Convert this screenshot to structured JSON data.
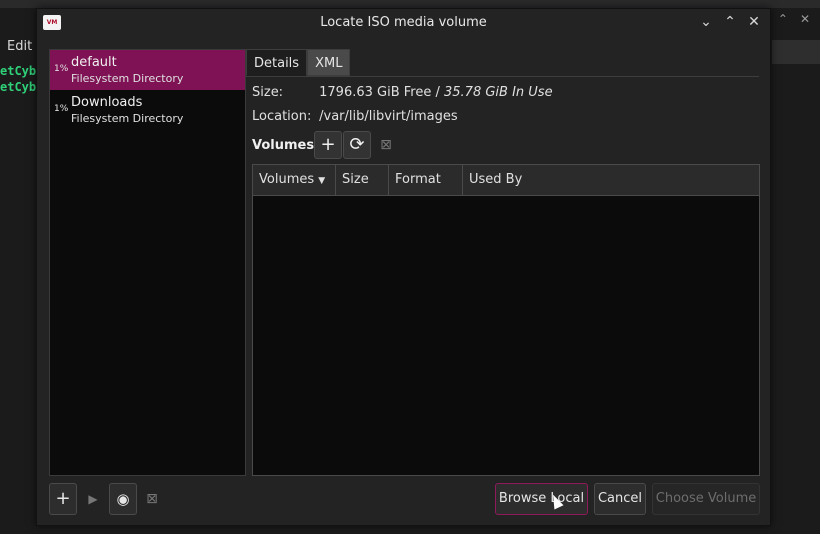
{
  "background": {
    "menu_edit": "Edit",
    "code_lines": [
      "etCyb",
      "etCyb"
    ],
    "icons": [
      "chevron-down-icon",
      "chevron-up-icon",
      "close-icon"
    ]
  },
  "dialog": {
    "title": "Locate ISO media volume",
    "app_icon_text": "VM",
    "window_controls": [
      "chevron-down-icon",
      "chevron-up-icon",
      "close-icon"
    ]
  },
  "pools": [
    {
      "percent": "1%",
      "name": "default",
      "type": "Filesystem Directory",
      "selected": true
    },
    {
      "percent": "1%",
      "name": "Downloads",
      "type": "Filesystem Directory",
      "selected": false
    }
  ],
  "tabs": [
    {
      "label": "Details",
      "active": true
    },
    {
      "label": "XML",
      "active": false
    }
  ],
  "details": {
    "size_label": "Size:",
    "size_free": "1796.63 GiB Free / ",
    "size_in_use": "35.78 GiB In Use",
    "location_label": "Location:",
    "location_value": "/var/lib/libvirt/images"
  },
  "volumes": {
    "label": "Volumes",
    "toolbar": [
      "add-icon",
      "refresh-icon",
      "delete-icon"
    ],
    "columns": [
      "Volumes",
      "Size",
      "Format",
      "Used By"
    ],
    "rows": []
  },
  "bottom": {
    "pool_tools": [
      "add-icon",
      "play-icon",
      "stop-icon",
      "delete-icon"
    ],
    "browse_local": "Browse Local",
    "cancel": "Cancel",
    "choose_volume": "Choose Volume"
  },
  "colors": {
    "accent": "#7e1254",
    "code_green": "#2fd179"
  }
}
